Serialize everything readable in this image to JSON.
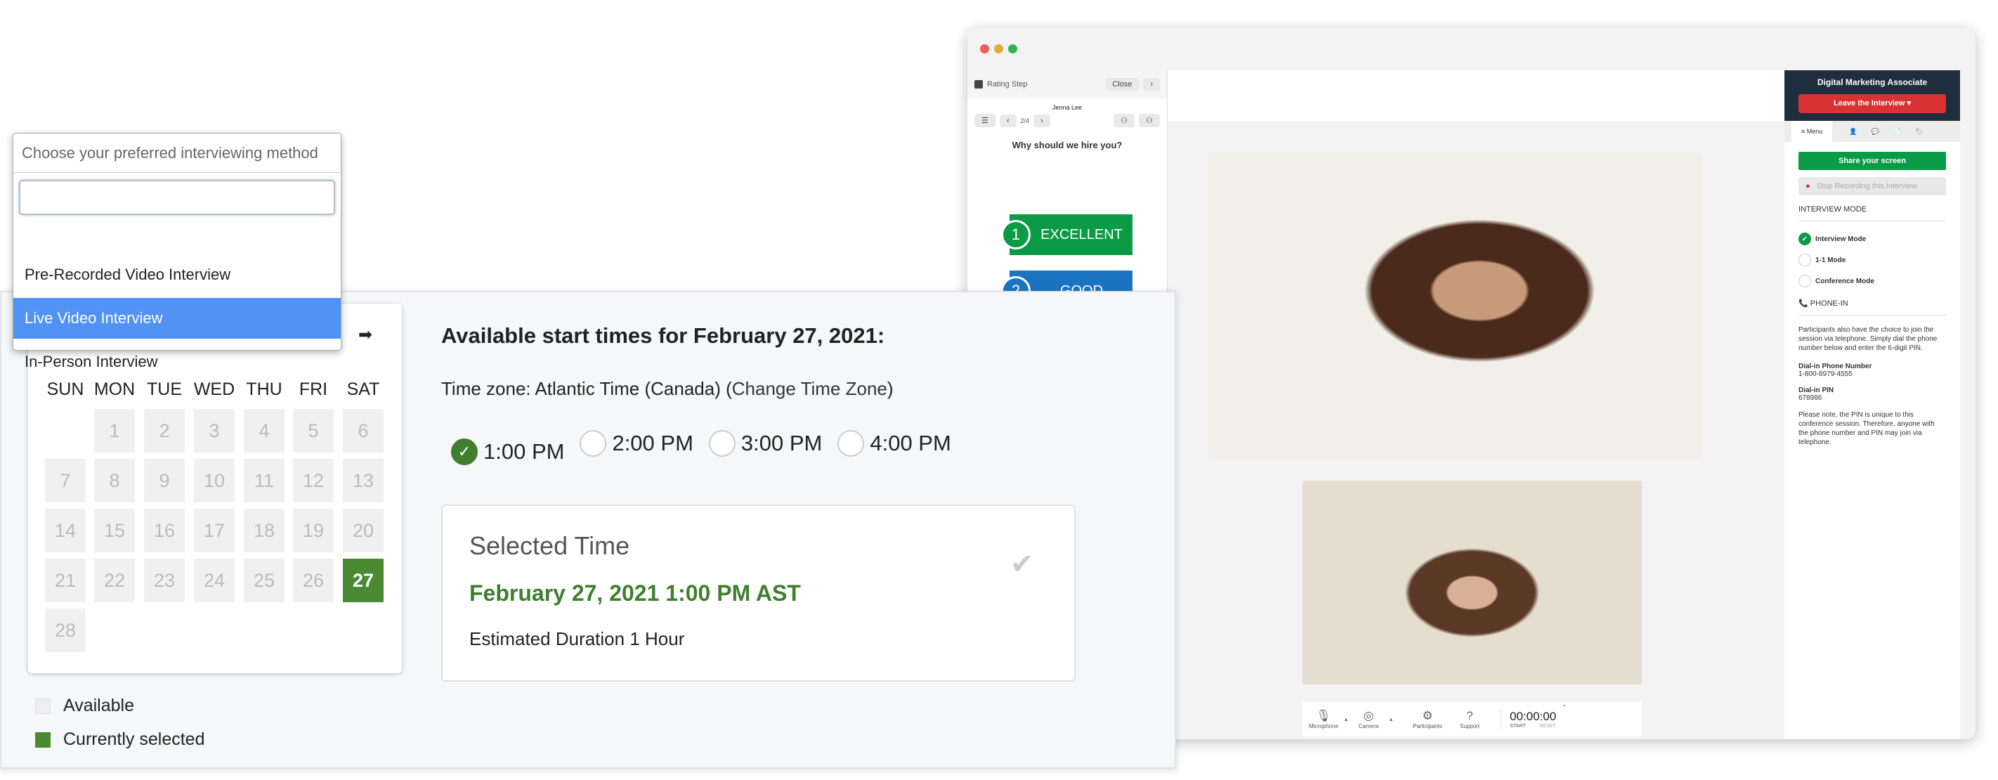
{
  "browser": {
    "traffic_colors": [
      "#ec5f57",
      "#e0a93a",
      "#37b24a"
    ]
  },
  "rating": {
    "title": "Rating Step",
    "close": "Close",
    "candidate": "Jenna Lee",
    "page": "2/4",
    "question": "Why should we hire you?",
    "options": [
      {
        "num": "1",
        "label": "EXCELLENT",
        "color": "#0b9a45"
      },
      {
        "num": "2",
        "label": "GOOD",
        "color": "#1b74c1"
      }
    ]
  },
  "right_panel": {
    "job_title": "Digital Marketing Associate",
    "leave": "Leave the Interview",
    "tab_menu": "Menu",
    "share": "Share your screen",
    "stop_recording": "Stop Recording this Interview",
    "interview_mode_heading": "INTERVIEW MODE",
    "modes": [
      {
        "label": "Interview Mode",
        "selected": true
      },
      {
        "label": "1-1 Mode",
        "selected": false
      },
      {
        "label": "Conference Mode",
        "selected": false
      }
    ],
    "phone_heading": "PHONE-IN",
    "phone_text": "Participants also have the choice to join the session via telephone. Simply dial the phone number below and enter the 6-digit PIN.",
    "dial_label": "Dial-in Phone Number",
    "dial_number": "1-800-8979-4555",
    "pin_label": "Dial-in PIN",
    "pin": "678986",
    "note": "Please note, the PIN is unique to this conference session. Therefore, anyone with the phone number and PIN may join via telephone."
  },
  "controls": {
    "items": [
      "Microphone",
      "Camera",
      "Participants",
      "Support"
    ],
    "timer": "00:00:00",
    "start": "START",
    "reset": "RESET"
  },
  "dropdown": {
    "placeholder": "Choose your preferred interviewing method",
    "search_value": "",
    "options": [
      "Pre-Recorded Video Interview",
      "Live Video Interview",
      "In-Person Interview"
    ],
    "highlighted": 1
  },
  "calendar": {
    "weekdays": [
      "SUN",
      "MON",
      "TUE",
      "WED",
      "THU",
      "FRI",
      "SAT"
    ],
    "first_weekday_index": 1,
    "days": 28,
    "selected_day": 27,
    "legend_available": "Available",
    "legend_selected": "Currently selected",
    "selected_color": "#4a8a32"
  },
  "schedule": {
    "heading": "Available start times for February 27, 2021:",
    "timezone_label": "Time zone: Atlantic Time (Canada) (",
    "change_tz": "Change Time Zone",
    "timezone_close": ")",
    "slots": [
      {
        "label": "1:00 PM",
        "selected": true
      },
      {
        "label": "2:00 PM",
        "selected": false
      },
      {
        "label": "3:00 PM",
        "selected": false
      },
      {
        "label": "4:00 PM",
        "selected": false
      }
    ],
    "selected_title": "Selected Time",
    "selected_value": "February 27, 2021 1:00 PM AST",
    "duration": "Estimated Duration 1 Hour"
  }
}
